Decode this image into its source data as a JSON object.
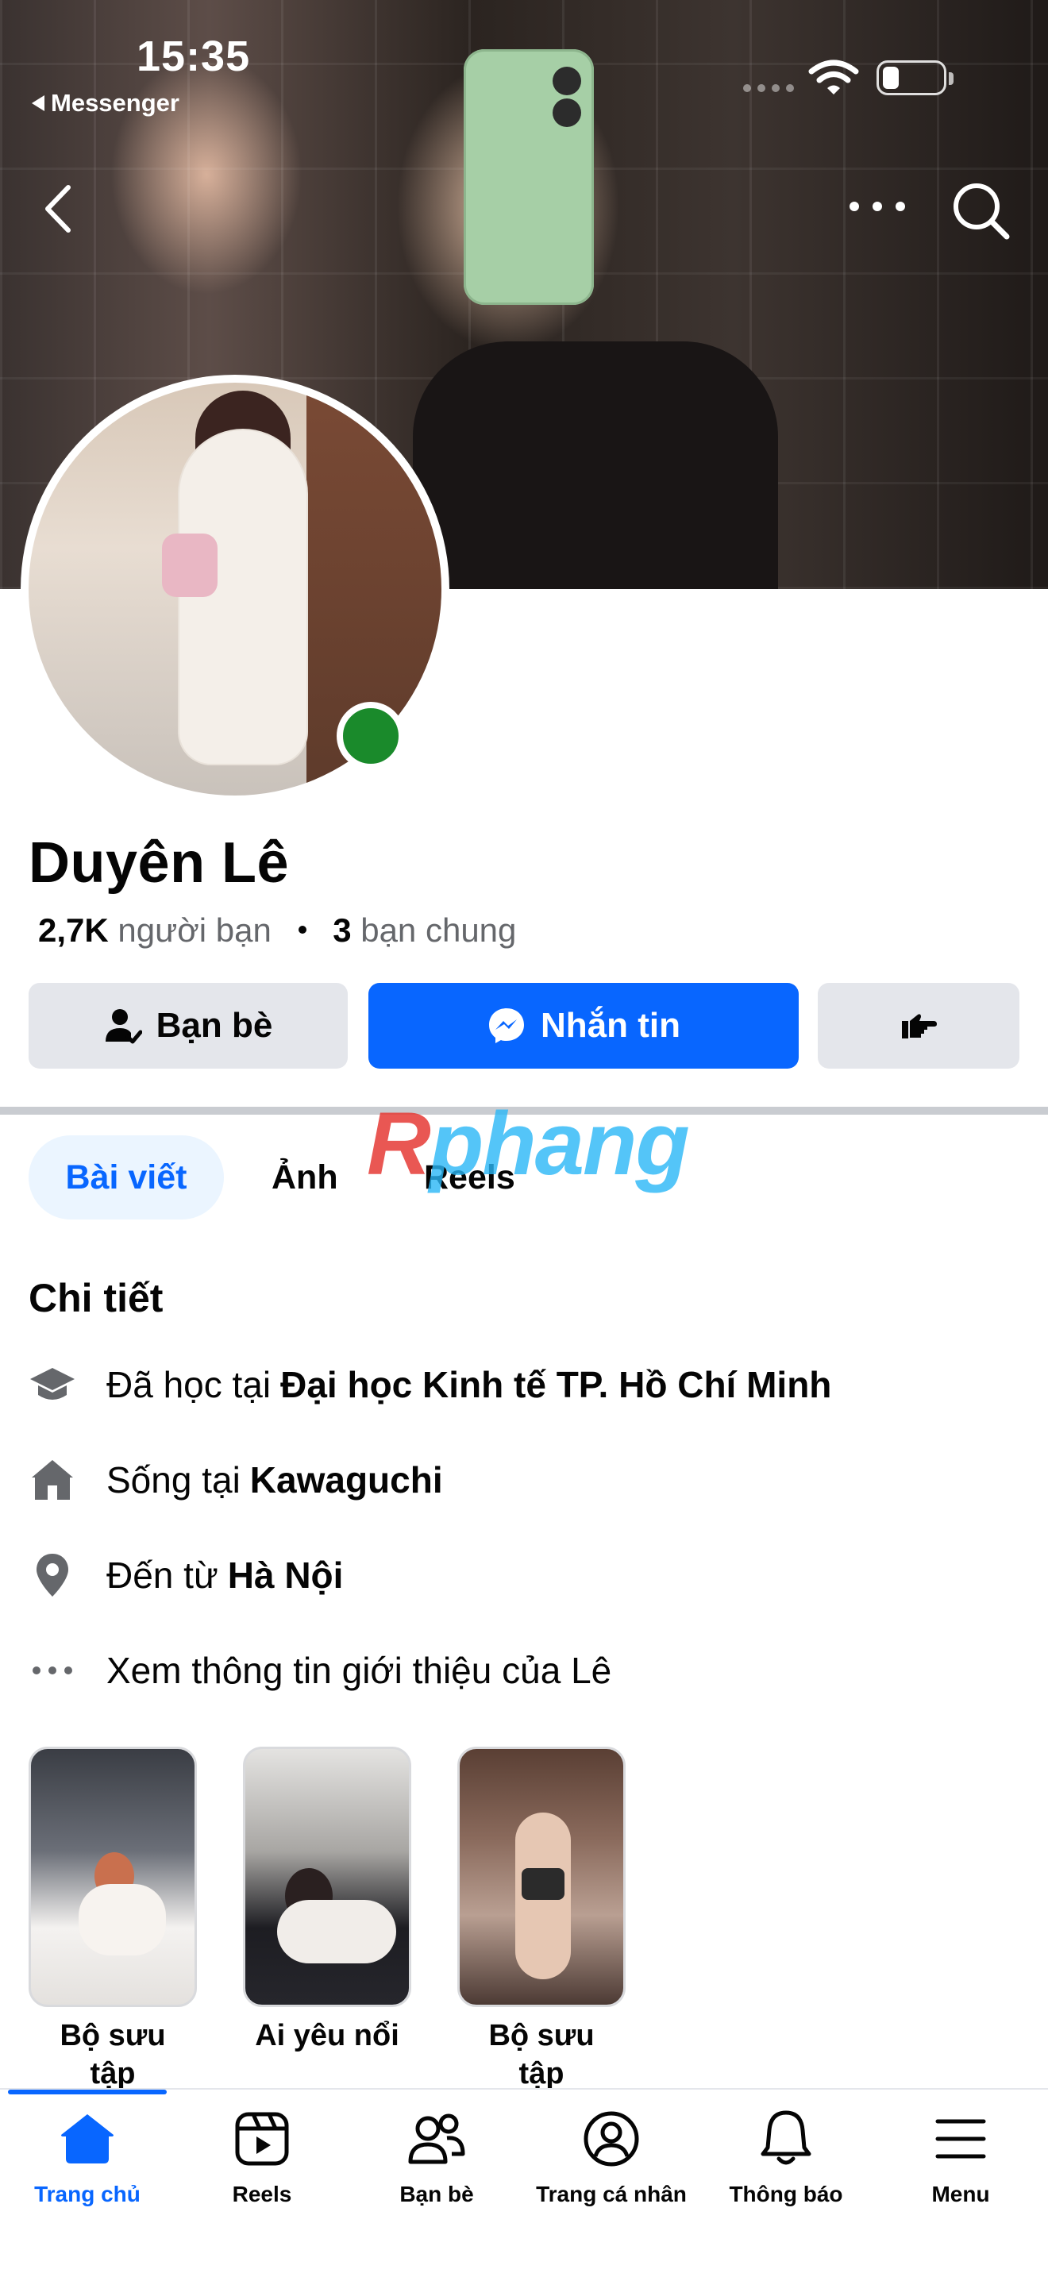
{
  "status_bar": {
    "time": "15:35",
    "back_app": "Messenger"
  },
  "profile": {
    "name": "Duyên Lê",
    "friends_count": "2,7K",
    "friends_label": "người bạn",
    "mutual_count": "3",
    "mutual_label": "bạn chung",
    "online": true
  },
  "actions": {
    "friends_label": "Bạn bè",
    "message_label": "Nhắn tin"
  },
  "tabs": [
    {
      "label": "Bài viết",
      "active": true
    },
    {
      "label": "Ảnh",
      "active": false
    },
    {
      "label": "Reels",
      "active": false
    }
  ],
  "watermark": {
    "first": "R",
    "rest": "phang"
  },
  "details": {
    "title": "Chi tiết",
    "items": [
      {
        "icon": "graduation-cap-icon",
        "prefix": "Đã học tại",
        "value": "Đại học Kinh tế TP. Hồ Chí Minh"
      },
      {
        "icon": "home-icon",
        "prefix": "Sống tại",
        "value": "Kawaguchi"
      },
      {
        "icon": "location-pin-icon",
        "prefix": "Đến từ",
        "value": "Hà Nội"
      },
      {
        "icon": "more-dots-icon",
        "prefix": "Xem thông tin giới thiệu của Lê",
        "value": ""
      }
    ]
  },
  "featured": [
    {
      "label_line1": "Bộ sưu",
      "label_line2": "tập"
    },
    {
      "label_line1": "Ai yêu nổi",
      "label_line2": ""
    },
    {
      "label_line1": "Bộ sưu",
      "label_line2": "tập"
    }
  ],
  "bottom_nav": [
    {
      "label": "Trang chủ",
      "icon": "home-icon",
      "active": true
    },
    {
      "label": "Reels",
      "icon": "reels-icon",
      "active": false
    },
    {
      "label": "Bạn bè",
      "icon": "friends-icon",
      "active": false
    },
    {
      "label": "Trang cá nhân",
      "icon": "profile-icon",
      "active": false
    },
    {
      "label": "Thông báo",
      "icon": "bell-icon",
      "active": false
    },
    {
      "label": "Menu",
      "icon": "hamburger-icon",
      "active": false
    }
  ],
  "colors": {
    "accent": "#0866ff",
    "secondary_button": "#e4e6eb",
    "online": "#1a8a2b",
    "muted_text": "#65676b"
  }
}
